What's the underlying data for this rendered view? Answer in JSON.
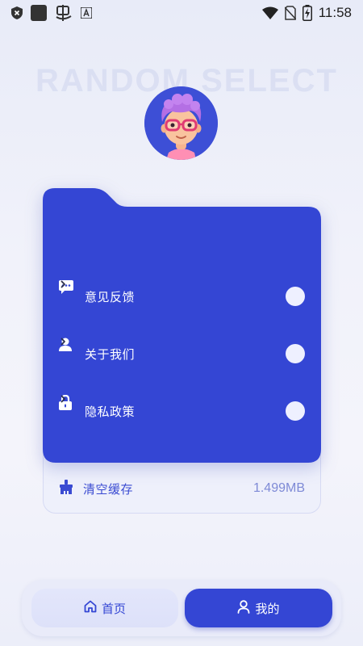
{
  "status_bar": {
    "time": "11:58",
    "left_icons": [
      "shield-x-icon",
      "square-app-icon",
      "bug-app-icon",
      "text-a-icon"
    ],
    "right_icons": [
      "wifi-icon",
      "no-sim-icon",
      "battery-charging-icon"
    ]
  },
  "watermark": "RANDOM SELECT",
  "profile": {
    "avatar_icon": "avatar-glasses-character"
  },
  "menu": {
    "items": [
      {
        "label": "意见反馈",
        "icon": "chat-bubble-icon"
      },
      {
        "label": "关于我们",
        "icon": "user-icon"
      },
      {
        "label": "隐私政策",
        "icon": "lock-icon"
      }
    ]
  },
  "cache": {
    "label": "清空缓存",
    "value": "1.499MB",
    "icon": "broom-icon"
  },
  "nav": {
    "home_label": "首页",
    "mine_label": "我的",
    "active": "mine"
  },
  "colors": {
    "primary": "#3446d4",
    "card_back": "#eef0fb",
    "accent_text": "#7e8ad6"
  }
}
